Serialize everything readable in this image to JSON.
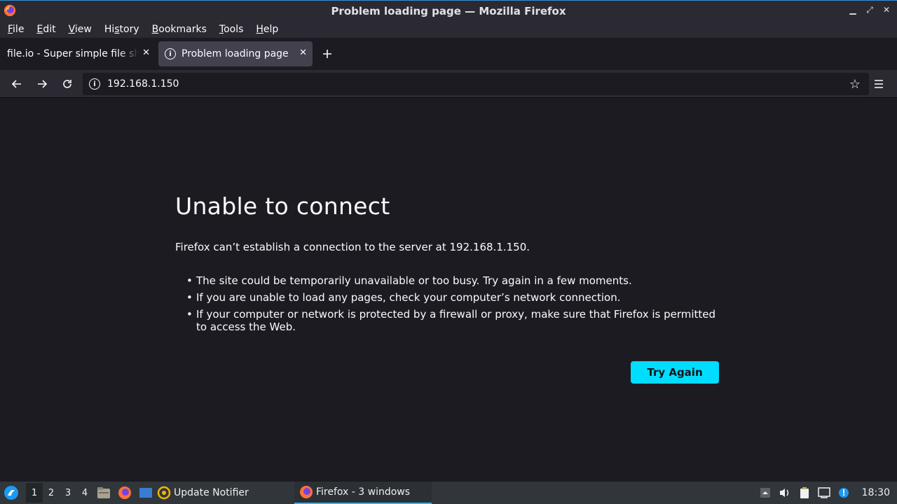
{
  "window": {
    "title": "Problem loading page — Mozilla Firefox",
    "controls": [
      "minimize",
      "maximize",
      "close"
    ]
  },
  "menubar": {
    "items": [
      {
        "label": "File",
        "accel": "F"
      },
      {
        "label": "Edit",
        "accel": "E"
      },
      {
        "label": "View",
        "accel": "V"
      },
      {
        "label": "History",
        "accel": "s"
      },
      {
        "label": "Bookmarks",
        "accel": "B"
      },
      {
        "label": "Tools",
        "accel": "T"
      },
      {
        "label": "Help",
        "accel": "H"
      }
    ]
  },
  "tabs": [
    {
      "label": "file.io - Super simple file sharing",
      "active": false
    },
    {
      "label": "Problem loading page",
      "active": true
    }
  ],
  "navbar": {
    "url": "192.168.1.150"
  },
  "error_page": {
    "title": "Unable to connect",
    "description": "Firefox can’t establish a connection to the server at 192.168.1.150.",
    "bullets": [
      "The site could be temporarily unavailable or too busy. Try again in a few moments.",
      "If you are unable to load any pages, check your computer’s network connection.",
      "If your computer or network is protected by a firewall or proxy, make sure that Firefox is permitted to access the Web."
    ],
    "button_label": "Try Again",
    "accent_color": "#00ddff"
  },
  "taskbar": {
    "workspaces": [
      "1",
      "2",
      "3",
      "4"
    ],
    "active_workspace": "1",
    "tasks": [
      {
        "label": "Update Notifier",
        "icon": "update-notifier-icon"
      },
      {
        "label": "Firefox - 3 windows",
        "icon": "firefox-icon"
      }
    ],
    "clock": "18:30"
  }
}
